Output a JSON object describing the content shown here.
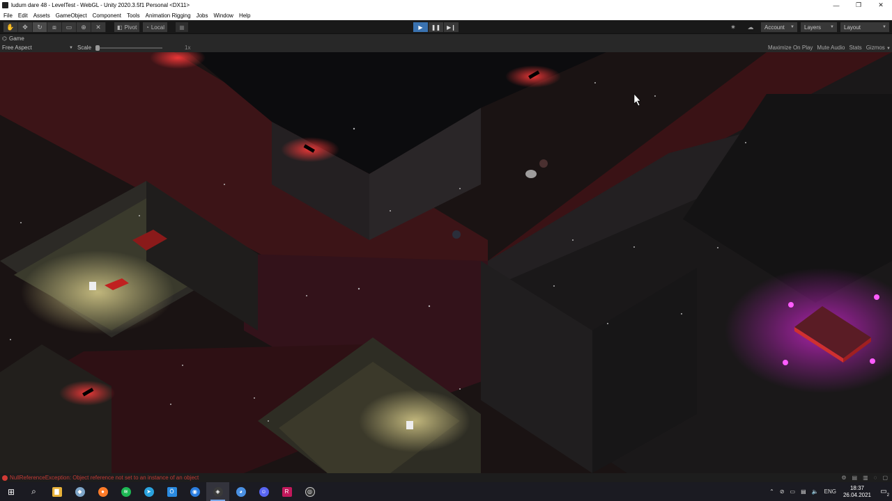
{
  "window": {
    "title": "ludum dare 48 - LevelTest - WebGL - Unity 2020.3.5f1 Personal <DX11>",
    "minimize": "—",
    "maximize": "❐",
    "close": "✕"
  },
  "menu": [
    "File",
    "Edit",
    "Assets",
    "GameObject",
    "Component",
    "Tools",
    "Animation Rigging",
    "Jobs",
    "Window",
    "Help"
  ],
  "toolbar": {
    "tools": [
      {
        "name": "hand-tool-icon",
        "glyph": "✋"
      },
      {
        "name": "move-tool-icon",
        "glyph": "✥"
      },
      {
        "name": "rotate-tool-icon",
        "glyph": "↻"
      },
      {
        "name": "scale-tool-icon",
        "glyph": "⧈"
      },
      {
        "name": "rect-tool-icon",
        "glyph": "▭"
      },
      {
        "name": "transform-tool-icon",
        "glyph": "⊕"
      },
      {
        "name": "custom-tool-icon",
        "glyph": "✕"
      }
    ],
    "pivot_label": "Pivot",
    "local_label": "Local",
    "play_glyph": "▶",
    "pause_glyph": "❚❚",
    "step_glyph": "▶❙",
    "account_label": "Account",
    "layers_label": "Layers",
    "layout_label": "Layout"
  },
  "game_tab": {
    "label": "Game",
    "aspect": "Free Aspect",
    "scale_label": "Scale",
    "scale_value": "1x",
    "options": [
      "Maximize On Play",
      "Mute Audio",
      "Stats",
      "Gizmos"
    ]
  },
  "status": {
    "error": "NullReferenceException: Object reference not set to an instance of an object"
  },
  "taskbar": {
    "apps": [
      {
        "name": "search-icon",
        "glyph": "⌕",
        "color": "transparent"
      },
      {
        "name": "file-explorer-icon",
        "glyph": "▇",
        "color": "#e8b23a"
      },
      {
        "name": "app-icon",
        "glyph": "◆",
        "color": "#7fa6c9"
      },
      {
        "name": "firefox-icon",
        "glyph": "●",
        "color": "#ff7b29"
      },
      {
        "name": "spotify-icon",
        "glyph": "≋",
        "color": "#1db954"
      },
      {
        "name": "telegram-icon",
        "glyph": "➤",
        "color": "#2aa3df"
      },
      {
        "name": "docs-icon",
        "glyph": "Ö",
        "color": "#2a8ae0"
      },
      {
        "name": "maps-icon",
        "glyph": "◉",
        "color": "#2a7de0"
      },
      {
        "name": "unity-icon",
        "glyph": "◈",
        "color": "#3a3a3a"
      },
      {
        "name": "chrome-icon",
        "glyph": "◕",
        "color": "#4a90e2"
      },
      {
        "name": "discord-icon",
        "glyph": "☺",
        "color": "#5865f2"
      },
      {
        "name": "rider-icon",
        "glyph": "R",
        "color": "#c2185b"
      },
      {
        "name": "obs-icon",
        "glyph": "◎",
        "color": "#333"
      }
    ],
    "language": "ENG",
    "time": "18:37",
    "date": "26.04.2021",
    "notifications": "2"
  },
  "colors": {
    "accent": "#3a72b0",
    "error": "#c23a34",
    "corridor": "#5a1a1e",
    "neon": "#d926d9"
  }
}
